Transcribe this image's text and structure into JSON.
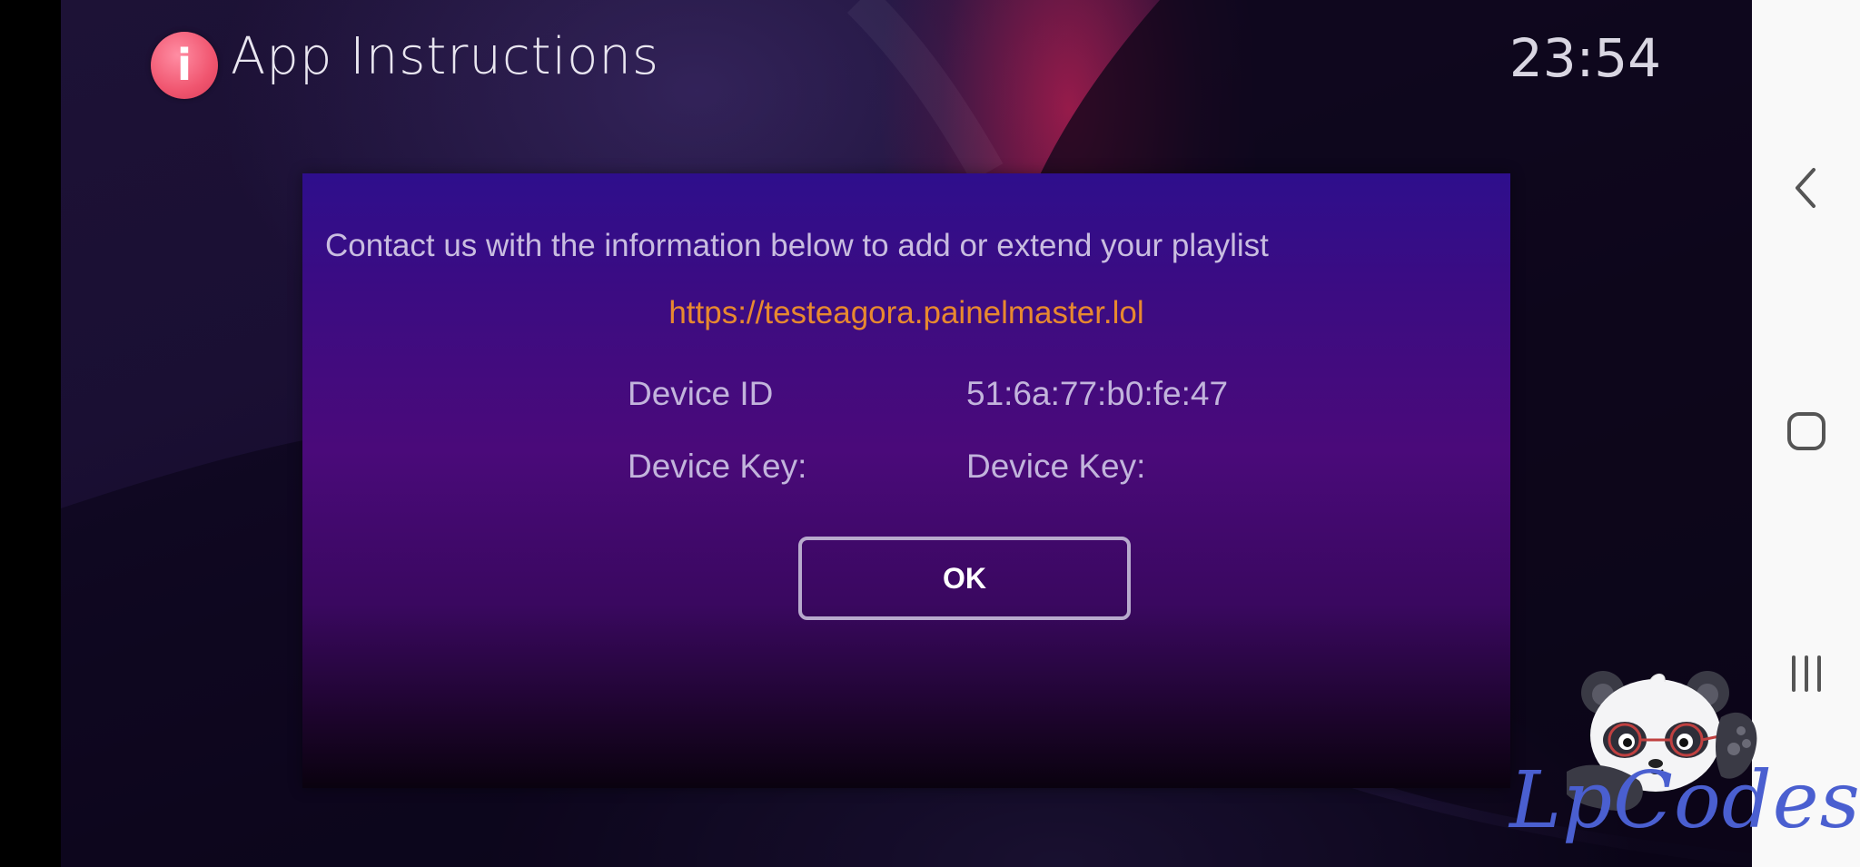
{
  "header": {
    "icon_glyph": "i",
    "icon_name": "info-icon",
    "title": "App Instructions",
    "clock": "23:54"
  },
  "dialog": {
    "message": "Contact us with the information below to add or extend your playlist",
    "url": "https://testeagora.painelmaster.lol",
    "rows": [
      {
        "label": "Device ID",
        "value": "51:6a:77:b0:fe:47"
      },
      {
        "label": "Device Key:",
        "value": "Device Key:"
      }
    ],
    "ok_label": "OK"
  },
  "nav_bar": {
    "back_icon": "chevron-left-icon",
    "home_icon": "rounded-square-icon",
    "recents_icon": "three-bars-icon"
  },
  "watermark": {
    "text": "LpCodes",
    "mascot": "panda-mascot"
  },
  "colors": {
    "accent_url": "#e8892f",
    "dialog_top": "#2e0e8c",
    "dialog_mid": "#4a0a7a",
    "header_icon": "#f0556f",
    "watermark": "#4a5fd0",
    "nav_bar_bg": "#f9f9f9"
  }
}
